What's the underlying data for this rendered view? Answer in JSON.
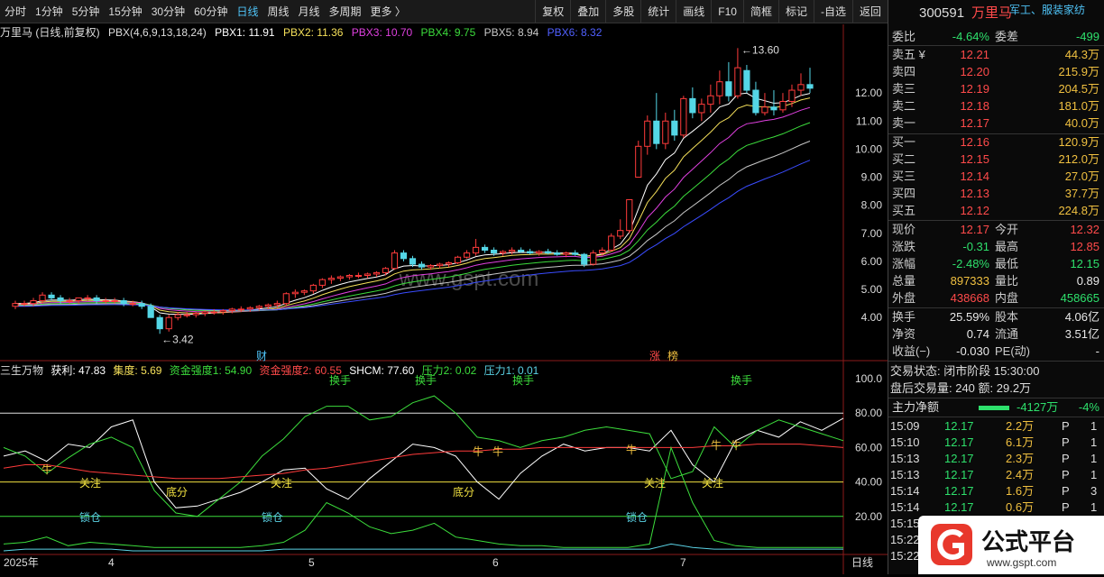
{
  "toolbar": {
    "left": [
      "分时",
      "1分钟",
      "5分钟",
      "15分钟",
      "30分钟",
      "60分钟",
      "日线",
      "周线",
      "月线",
      "多周期",
      "更多 〉"
    ],
    "active": "日线",
    "right": [
      "复权",
      "叠加",
      "多股",
      "统计",
      "画线",
      "F10",
      "简框",
      "标记",
      "-自选",
      "返回"
    ]
  },
  "main_header": {
    "stock": "万里马 (日线,前复权)",
    "indicator": "PBX(4,6,9,13,18,24)",
    "pbx1": "PBX1: 11.91",
    "pbx2": "PBX2: 11.36",
    "pbx3": "PBX3: 10.70",
    "pbx4": "PBX4: 9.75",
    "pbx5": "PBX5: 8.94",
    "pbx6": "PBX6: 8.32"
  },
  "price_axis": [
    "12.00",
    "11.00",
    "10.00",
    "9.00",
    "8.00",
    "7.00",
    "6.00",
    "5.00",
    "4.00"
  ],
  "annotations": {
    "high": "13.60",
    "low": "3.42",
    "cai": "财",
    "zhang": "涨",
    "bang": "榜"
  },
  "watermark": "www.gspt.com",
  "sub_header": {
    "name": "三生万物",
    "hl": "获利: 47.83",
    "jd": "集度: 5.69",
    "qd1": "资金强度1: 54.90",
    "qd2": "资金强度2: 60.55",
    "shcm": "SHCM: 77.60",
    "yl2": "压力2: 0.02",
    "yl1": "压力1: 0.01"
  },
  "sub_axis": [
    "100.0",
    "80.00",
    "60.00",
    "40.00",
    "20.00"
  ],
  "sub_labels": {
    "niu": "牛",
    "guanzhu": "关注",
    "difen": "底分",
    "suocang": "锁仓",
    "huanshou": "换手"
  },
  "time_axis": [
    "2025年",
    "4",
    "5",
    "6",
    "7"
  ],
  "period_label": "日线",
  "chart_data": {
    "type": "candlestick",
    "x": [
      "2025-03",
      "2025-04",
      "2025-05",
      "2025-06",
      "2025-07"
    ],
    "price_high": 13.6,
    "price_low": 3.42,
    "ylim": [
      3.3,
      13.9
    ],
    "sub_ylim": [
      0,
      100
    ],
    "candles": [
      [
        4.4,
        4.6,
        4.3,
        4.5
      ],
      [
        4.5,
        4.6,
        4.4,
        4.5
      ],
      [
        4.5,
        4.7,
        4.4,
        4.6
      ],
      [
        4.6,
        4.9,
        4.5,
        4.8
      ],
      [
        4.8,
        4.9,
        4.6,
        4.7
      ],
      [
        4.7,
        4.8,
        4.5,
        4.6
      ],
      [
        4.6,
        4.7,
        4.5,
        4.6
      ],
      [
        4.6,
        4.7,
        4.5,
        4.7
      ],
      [
        4.7,
        4.8,
        4.6,
        4.7
      ],
      [
        4.7,
        4.8,
        4.5,
        4.6
      ],
      [
        4.6,
        4.7,
        4.5,
        4.6
      ],
      [
        4.6,
        4.7,
        4.5,
        4.6
      ],
      [
        4.6,
        4.7,
        4.4,
        4.5
      ],
      [
        4.5,
        4.6,
        4.4,
        4.5
      ],
      [
        4.5,
        4.6,
        4.3,
        4.4
      ],
      [
        4.4,
        4.5,
        4.0,
        4.0
      ],
      [
        4.0,
        4.1,
        3.42,
        3.6
      ],
      [
        3.6,
        4.1,
        3.5,
        4.0
      ],
      [
        4.0,
        4.2,
        3.9,
        4.1
      ],
      [
        4.1,
        4.2,
        4.0,
        4.1
      ],
      [
        4.1,
        4.2,
        4.0,
        4.15
      ],
      [
        4.15,
        4.25,
        4.05,
        4.2
      ],
      [
        4.2,
        4.3,
        4.1,
        4.2
      ],
      [
        4.2,
        4.3,
        4.1,
        4.25
      ],
      [
        4.25,
        4.35,
        4.15,
        4.3
      ],
      [
        4.3,
        4.4,
        4.2,
        4.3
      ],
      [
        4.3,
        4.4,
        4.2,
        4.35
      ],
      [
        4.35,
        4.45,
        4.25,
        4.4
      ],
      [
        4.4,
        4.5,
        4.3,
        4.45
      ],
      [
        4.45,
        4.6,
        4.35,
        4.5
      ],
      [
        4.5,
        4.9,
        4.4,
        4.85
      ],
      [
        4.85,
        5.0,
        4.7,
        4.9
      ],
      [
        4.9,
        5.0,
        4.8,
        4.95
      ],
      [
        4.95,
        5.2,
        4.85,
        5.15
      ],
      [
        5.15,
        5.4,
        5.05,
        5.35
      ],
      [
        5.35,
        5.5,
        5.2,
        5.4
      ],
      [
        5.4,
        5.5,
        5.3,
        5.45
      ],
      [
        5.45,
        5.55,
        5.35,
        5.5
      ],
      [
        5.5,
        5.6,
        5.4,
        5.5
      ],
      [
        5.5,
        5.6,
        5.4,
        5.55
      ],
      [
        5.55,
        5.65,
        5.45,
        5.6
      ],
      [
        5.6,
        5.8,
        5.5,
        5.75
      ],
      [
        5.75,
        6.4,
        5.7,
        6.3
      ],
      [
        6.3,
        6.4,
        6.0,
        6.1
      ],
      [
        6.1,
        6.2,
        5.8,
        5.9
      ],
      [
        5.9,
        6.0,
        5.7,
        5.8
      ],
      [
        5.8,
        5.9,
        5.7,
        5.85
      ],
      [
        5.85,
        5.95,
        5.75,
        5.9
      ],
      [
        5.9,
        6.0,
        5.8,
        5.95
      ],
      [
        5.95,
        6.2,
        5.9,
        6.15
      ],
      [
        6.15,
        6.4,
        6.1,
        6.3
      ],
      [
        6.3,
        6.8,
        6.2,
        6.5
      ],
      [
        6.5,
        6.6,
        6.3,
        6.4
      ],
      [
        6.4,
        6.5,
        6.2,
        6.3
      ],
      [
        6.3,
        6.4,
        6.2,
        6.35
      ],
      [
        6.35,
        6.5,
        6.25,
        6.4
      ],
      [
        6.4,
        6.5,
        6.3,
        6.35
      ],
      [
        6.35,
        6.45,
        6.25,
        6.3
      ],
      [
        6.3,
        6.4,
        6.2,
        6.35
      ],
      [
        6.35,
        6.45,
        6.25,
        6.3
      ],
      [
        6.3,
        6.4,
        6.2,
        6.25
      ],
      [
        6.25,
        6.35,
        6.15,
        6.3
      ],
      [
        6.3,
        6.4,
        6.2,
        6.25
      ],
      [
        6.25,
        6.3,
        5.8,
        5.9
      ],
      [
        5.9,
        6.4,
        5.85,
        6.3
      ],
      [
        6.3,
        6.5,
        6.2,
        6.4
      ],
      [
        6.4,
        7.0,
        6.35,
        6.9
      ],
      [
        6.9,
        7.5,
        6.8,
        7.1
      ],
      [
        7.1,
        8.2,
        7.0,
        8.2
      ],
      [
        9.0,
        10.3,
        9.0,
        10.1
      ],
      [
        10.1,
        11.2,
        9.8,
        11.0
      ],
      [
        11.0,
        12.0,
        10.0,
        10.2
      ],
      [
        10.2,
        11.3,
        10.0,
        11.0
      ],
      [
        11.0,
        11.4,
        10.3,
        10.5
      ],
      [
        10.5,
        11.9,
        10.4,
        11.8
      ],
      [
        11.8,
        12.2,
        11.1,
        11.3
      ],
      [
        11.3,
        11.8,
        11.0,
        11.6
      ],
      [
        11.6,
        12.3,
        11.3,
        11.9
      ],
      [
        11.9,
        12.8,
        11.6,
        12.4
      ],
      [
        12.4,
        13.1,
        11.7,
        11.9
      ],
      [
        11.9,
        13.6,
        11.8,
        12.9
      ],
      [
        12.8,
        13.0,
        12.0,
        12.1
      ],
      [
        12.1,
        12.4,
        11.2,
        11.3
      ],
      [
        11.3,
        12.0,
        11.2,
        11.5
      ],
      [
        11.5,
        12.1,
        11.2,
        11.4
      ],
      [
        11.4,
        12.0,
        11.3,
        11.7
      ],
      [
        11.7,
        12.3,
        11.5,
        12.1
      ],
      [
        12.1,
        12.7,
        11.9,
        12.3
      ],
      [
        12.3,
        12.9,
        12.0,
        12.17
      ]
    ],
    "series_names": [
      "PBX1",
      "PBX2",
      "PBX3",
      "PBX4",
      "PBX5",
      "PBX6"
    ]
  },
  "quote": {
    "code": "300591",
    "name": "万里马",
    "tag": "军工、服装家纺",
    "wb_label": "委比",
    "wb": "-4.64%",
    "wc_label": "委差",
    "wc": "-499",
    "asks": [
      [
        "卖五 ¥",
        "12.21",
        "44.3万"
      ],
      [
        "卖四",
        "12.20",
        "215.9万"
      ],
      [
        "卖三",
        "12.19",
        "204.5万"
      ],
      [
        "卖二",
        "12.18",
        "181.0万"
      ],
      [
        "卖一",
        "12.17",
        "40.0万"
      ]
    ],
    "bids": [
      [
        "买一",
        "12.16",
        "120.9万"
      ],
      [
        "买二",
        "12.15",
        "212.0万"
      ],
      [
        "买三",
        "12.14",
        "27.0万"
      ],
      [
        "买四",
        "12.13",
        "37.7万"
      ],
      [
        "买五",
        "12.12",
        "224.8万"
      ]
    ],
    "stats": [
      [
        "现价",
        "12.17",
        "今开",
        "12.32"
      ],
      [
        "涨跌",
        "-0.31",
        "最高",
        "12.85"
      ],
      [
        "涨幅",
        "-2.48%",
        "最低",
        "12.15"
      ],
      [
        "总量",
        "897333",
        "量比",
        "0.89"
      ],
      [
        "外盘",
        "438668",
        "内盘",
        "458665"
      ]
    ],
    "stats2": [
      [
        "换手",
        "25.59%",
        "股本",
        "4.06亿"
      ],
      [
        "净资",
        "0.74",
        "流通",
        "3.51亿"
      ],
      [
        "收益(−)",
        "-0.030",
        "PE(动)",
        "-"
      ]
    ],
    "trade_status": "交易状态: 闭市阶段 15:30:00",
    "after_hours": "盘后交易量: 240  额: 29.2万",
    "main_flow_label": "主力净额",
    "main_flow": "-4127万",
    "main_flow_pct": "-4%",
    "ticks": [
      [
        "15:09",
        "12.17",
        "2.2万",
        "P",
        "1"
      ],
      [
        "15:10",
        "12.17",
        "6.1万",
        "P",
        "1"
      ],
      [
        "15:13",
        "12.17",
        "2.3万",
        "P",
        "1"
      ],
      [
        "15:13",
        "12.17",
        "2.4万",
        "P",
        "1"
      ],
      [
        "15:14",
        "12.17",
        "1.6万",
        "P",
        "3"
      ],
      [
        "15:14",
        "12.17",
        "0.6万",
        "P",
        "1"
      ],
      [
        "15:15",
        "",
        "",
        "",
        ""
      ],
      [
        "15:22",
        "",
        "",
        "",
        ""
      ],
      [
        "15:22",
        "",
        "",
        "",
        ""
      ]
    ]
  },
  "logo": {
    "text": "公式平台",
    "url": "www.gspt.com"
  },
  "colors": {
    "up": "#ff3b3b",
    "down": "#54d6e6",
    "pbx1": "#ffffff",
    "pbx2": "#f5e05a",
    "pbx3": "#e040e0",
    "pbx4": "#3cdc3c",
    "pbx5": "#c8c8c8",
    "pbx6": "#3a4cff"
  }
}
